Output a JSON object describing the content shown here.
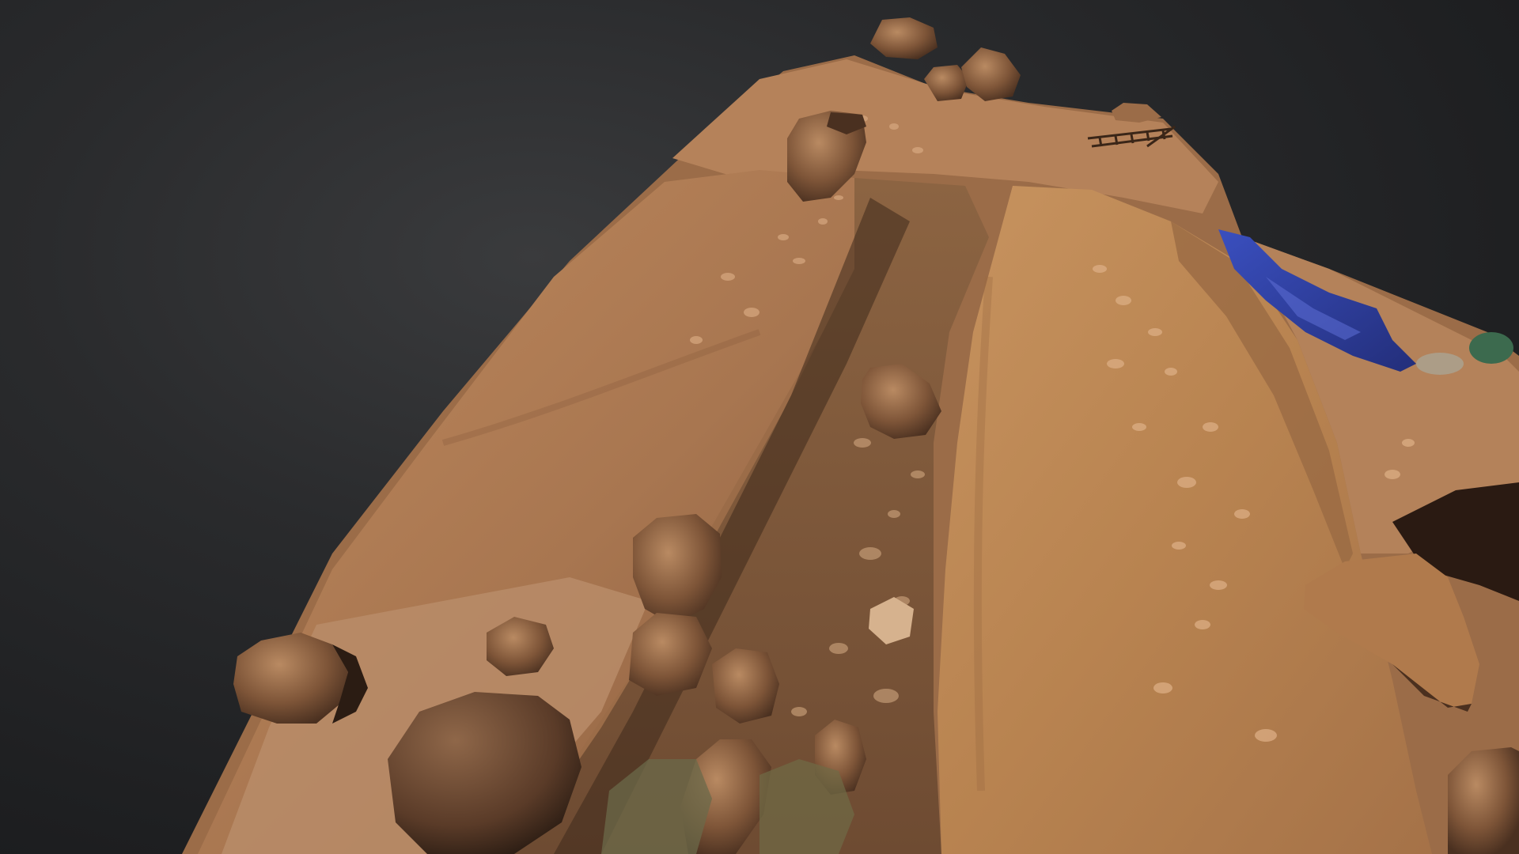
{
  "viewer": {
    "background_color": "#232426",
    "model": {
      "subject": "rock-outcrop-3d-scan",
      "rock_base_color": "#b07a52",
      "rock_shadow_color": "#5a3a27",
      "rock_highlight_color": "#d19a6c",
      "tarp_color": "#2f3f9e",
      "scale_ladder_icon": "ladder-icon"
    }
  }
}
